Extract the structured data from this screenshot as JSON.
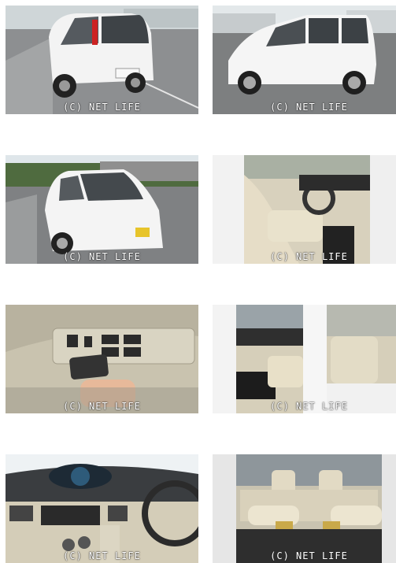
{
  "watermark": "(C) NET LIFE",
  "photos": [
    {
      "subject": "rear three-quarter view"
    },
    {
      "subject": "side view"
    },
    {
      "subject": "front three-quarter view"
    },
    {
      "subject": "front seats from driver door"
    },
    {
      "subject": "driver door window switches and key"
    },
    {
      "subject": "interior from passenger side"
    },
    {
      "subject": "dashboard and steering wheel"
    },
    {
      "subject": "rear seats"
    }
  ]
}
